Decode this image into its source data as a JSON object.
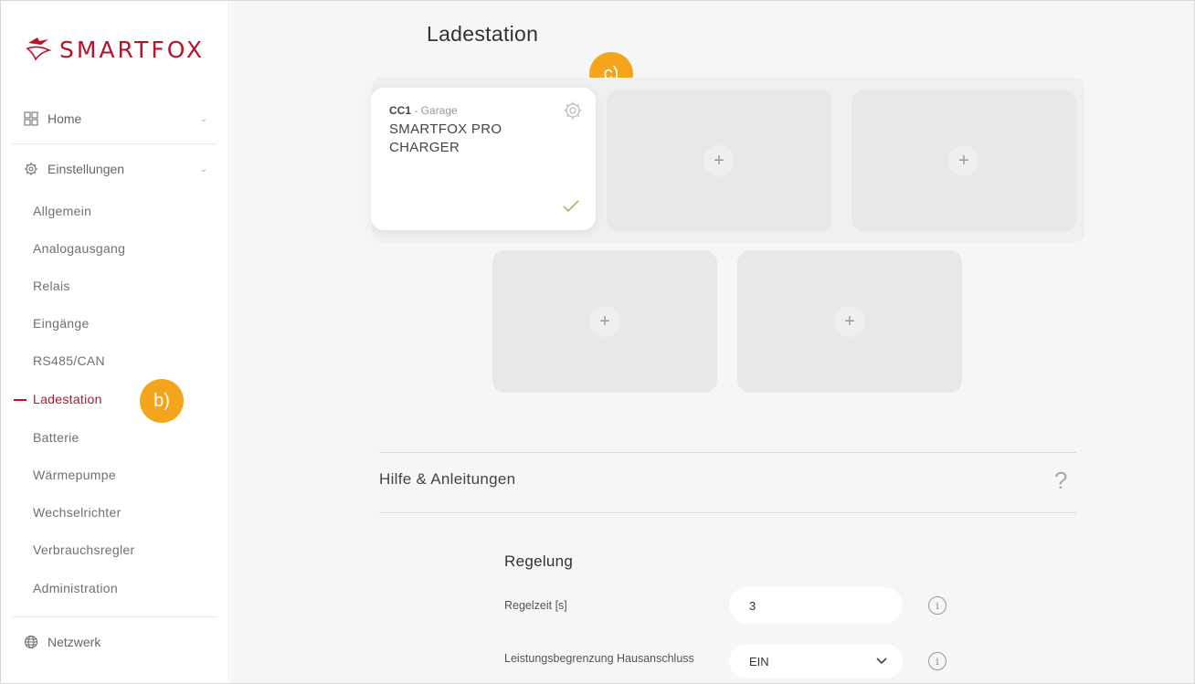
{
  "brand": {
    "name": "SMARTFOX",
    "color": "#b9122a"
  },
  "sidebar": {
    "home_label": "Home",
    "settings_label": "Einstellungen",
    "items": [
      {
        "label": "Allgemein"
      },
      {
        "label": "Analogausgang"
      },
      {
        "label": "Relais"
      },
      {
        "label": "Eingänge"
      },
      {
        "label": "RS485/CAN"
      },
      {
        "label": "Ladestation",
        "active": true
      },
      {
        "label": "Batterie"
      },
      {
        "label": "Wärmepumpe"
      },
      {
        "label": "Wechselrichter"
      },
      {
        "label": "Verbrauchsregler"
      },
      {
        "label": "Administration"
      }
    ],
    "network_label": "Netzwerk"
  },
  "annotations": {
    "b": "b)",
    "c": "c)",
    "color": "#f4a51c"
  },
  "main": {
    "title": "Ladestation",
    "charger": {
      "id": "CC1",
      "location": " - Garage",
      "name": "SMARTFOX PRO CHARGER"
    },
    "empty_slot_symbol": "+",
    "help_label": "Hilfe & Anleitungen",
    "help_icon": "?",
    "regelung": {
      "title": "Regelung",
      "regelzeit_label": "Regelzeit [s]",
      "regelzeit_value": "3",
      "leistung_label": "Leistungsbegrenzung Hausanschluss",
      "leistung_value": "EIN",
      "info_symbol": "i"
    }
  }
}
